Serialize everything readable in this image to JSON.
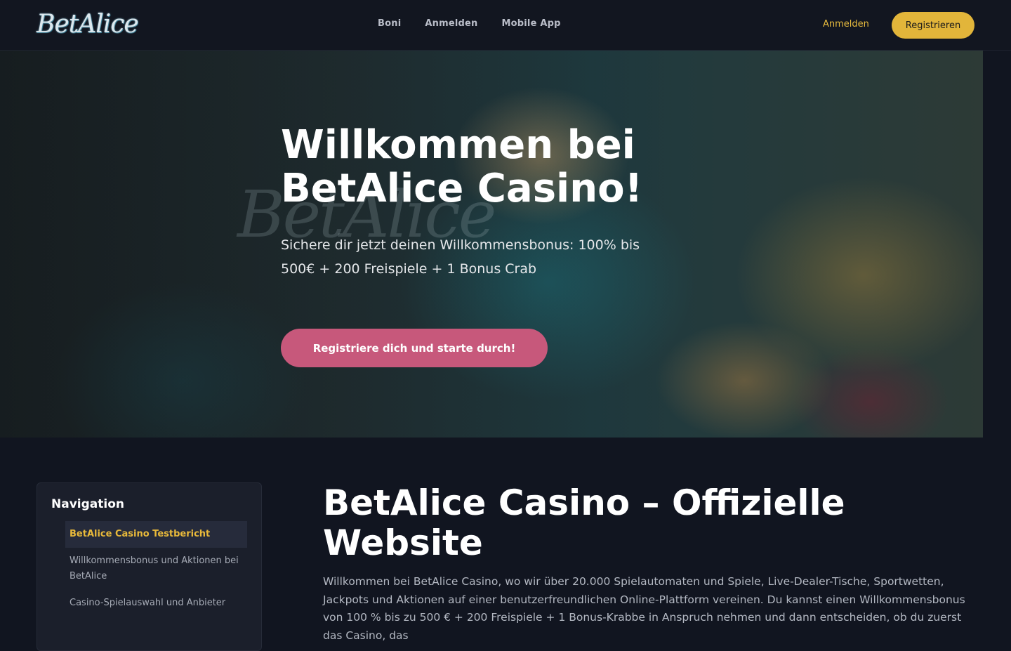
{
  "header": {
    "logo": "BetAlice",
    "nav": [
      "Boni",
      "Anmelden",
      "Mobile App"
    ],
    "login_label": "Anmelden",
    "register_label": "Registrieren"
  },
  "hero": {
    "watermark": "BetAlice",
    "title": "Willkommen bei BetAlice Casino!",
    "subtitle": "Sichere dir jetzt deinen Willkommensbonus: 100% bis 500€ + 200 Freispiele + 1 Bonus Crab",
    "cta_label": "Registriere dich und starte durch!"
  },
  "sidebar": {
    "title": "Navigation",
    "items": [
      {
        "label": "BetAlice Casino Testbericht",
        "active": true
      },
      {
        "label": "Willkommensbonus und Aktionen bei BetAlice",
        "active": false
      },
      {
        "label": "Casino-Spielauswahl und Anbieter",
        "active": false
      }
    ]
  },
  "main": {
    "title": "BetAlice Casino – Offizielle Website",
    "intro": "Willkommen bei BetAlice Casino, wo wir über 20.000 Spielautomaten und Spiele, Live-Dealer-Tische, Sportwetten, Jackpots und Aktionen auf einer benutzerfreundlichen Online-Plattform vereinen. Du kannst einen Willkommensbonus von 100 % bis zu 500 € + 200 Freispiele + 1 Bonus-Krabbe in Anspruch nehmen und dann entscheiden, ob du zuerst das Casino, das"
  },
  "colors": {
    "accent": "#e2b53a",
    "cta": "#c7587b",
    "background": "#111520"
  }
}
